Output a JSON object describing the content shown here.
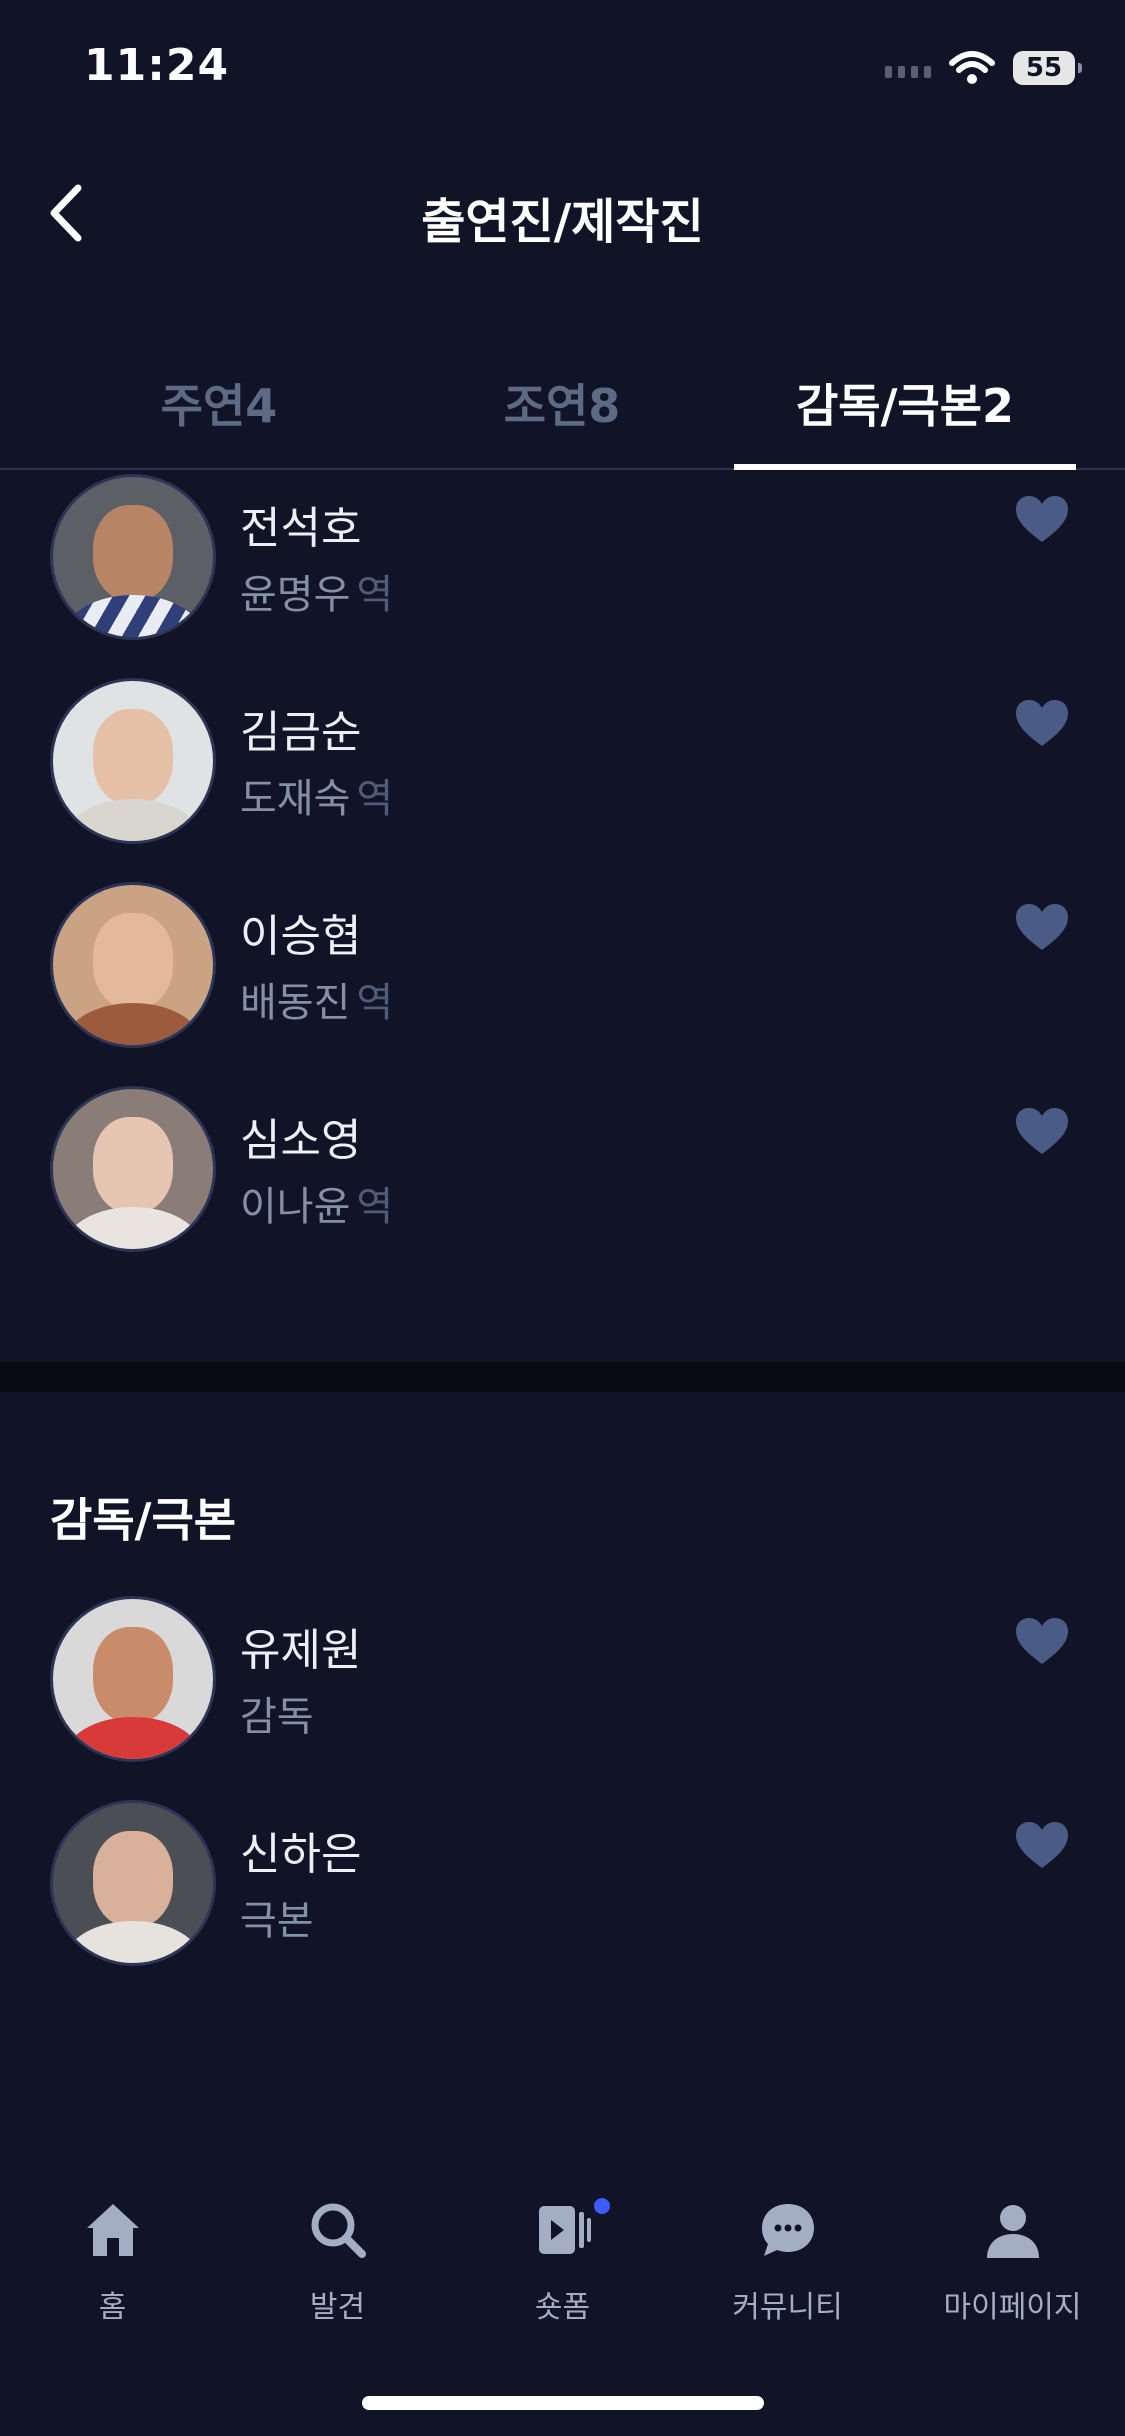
{
  "status_bar": {
    "time": "11:24",
    "battery": "55"
  },
  "header": {
    "title": "출연진/제작진"
  },
  "tabs": [
    {
      "label": "주연4",
      "active": false
    },
    {
      "label": "조연8",
      "active": false
    },
    {
      "label": "감독/극본2",
      "active": true
    }
  ],
  "cast": [
    {
      "name": "전석호",
      "role": "윤명우",
      "suffix": "역"
    },
    {
      "name": "김금순",
      "role": "도재숙",
      "suffix": "역"
    },
    {
      "name": "이승협",
      "role": "배동진",
      "suffix": "역"
    },
    {
      "name": "심소영",
      "role": "이나윤",
      "suffix": "역"
    }
  ],
  "crew_section": {
    "title": "감독/극본",
    "items": [
      {
        "name": "유제원",
        "role": "감독"
      },
      {
        "name": "신하은",
        "role": "극본"
      }
    ]
  },
  "bottom_nav": [
    {
      "label": "홈",
      "icon": "home-icon"
    },
    {
      "label": "발견",
      "icon": "search-icon"
    },
    {
      "label": "숏폼",
      "icon": "shortform-icon"
    },
    {
      "label": "커뮤니티",
      "icon": "chat-icon"
    },
    {
      "label": "마이페이지",
      "icon": "person-icon"
    }
  ],
  "colors": {
    "background": "#111427",
    "heart": "#4a5b85",
    "inactive_tab": "#5c6a84",
    "badge": "#3d5cff"
  }
}
